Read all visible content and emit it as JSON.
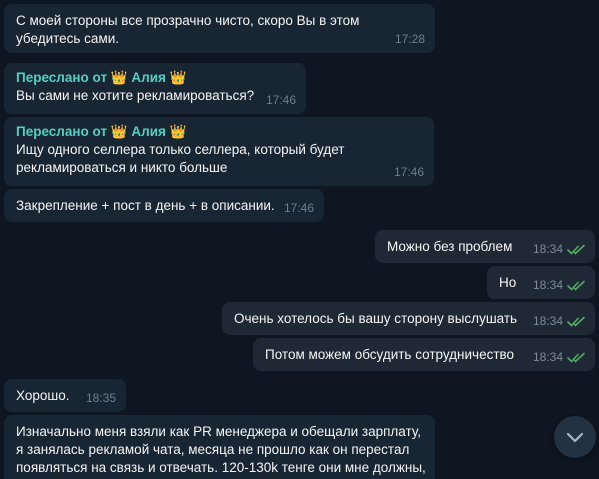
{
  "messages": {
    "m1": {
      "text": "С моей стороны все прозрачно чисто, скоро Вы в этом убедитесь сами.",
      "time": "17:28"
    },
    "m2": {
      "forwarded": "Переслано от 👑 Алия 👑",
      "text": "Вы сами не хотите рекламироваться?",
      "time": "17:46"
    },
    "m3": {
      "forwarded": "Переслано от 👑 Алия 👑",
      "text": "Ищу одного селлера только селлера, который будет рекламироваться и никто больше",
      "time": "17:46"
    },
    "m4": {
      "text": "Закрепление + пост в день + в описании.",
      "time": "17:46"
    },
    "m5": {
      "text": "Можно без проблем",
      "time": "18:34"
    },
    "m6": {
      "text": "Но",
      "time": "18:34"
    },
    "m7": {
      "text": "Очень хотелось бы вашу сторону выслушать",
      "time": "18:34"
    },
    "m8": {
      "text": "Потом можем обсудить сотрудничество",
      "time": "18:34"
    },
    "m9": {
      "text": "Хорошо.",
      "time": "18:35"
    },
    "m10": {
      "text": "Изначально меня взяли как PR менеджера и обещали зарплату, я занялась рекламой чата, месяца не прошло как он перестал появляться на связь и отвечать. 120-130k тенге они мне должны,"
    }
  },
  "colors": {
    "background": "#0e1621",
    "incoming": "#182533",
    "outgoing": "#1f2936",
    "forward_name": "#4fd1c5",
    "read_ticks": "#4fae5e"
  },
  "icons": {
    "read": "double-check-icon",
    "scroll": "chevron-down-icon"
  }
}
